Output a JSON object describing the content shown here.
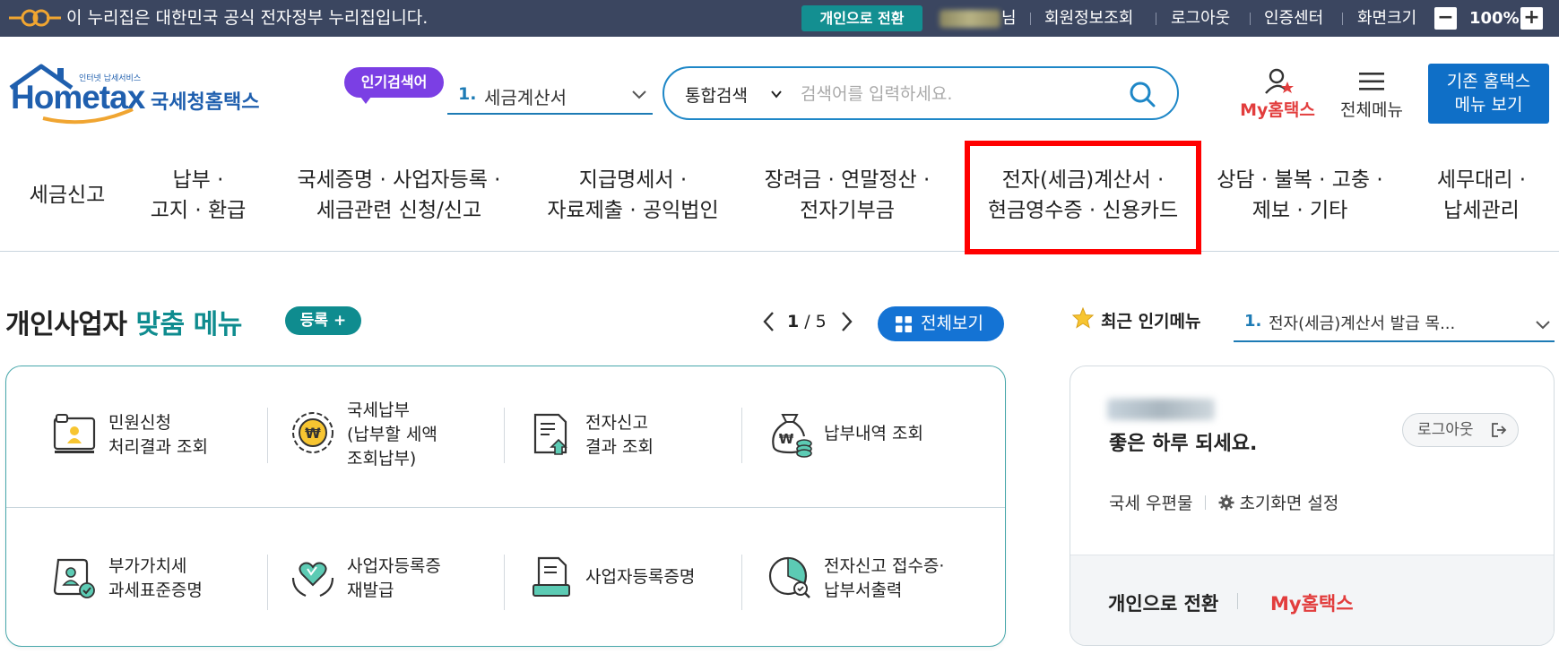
{
  "topbar": {
    "gov_notice": "이 누리집은 대한민국 공식 전자정부 누리집입니다.",
    "switch_label": "개인으로 전환",
    "user_suffix": "님",
    "links": [
      "회원정보조회",
      "로그아웃",
      "인증센터",
      "화면크기"
    ],
    "zoom_minus": "−",
    "zoom_value": "100%",
    "zoom_plus": "+"
  },
  "header": {
    "logo_top": "인터넷 납세서비스",
    "logo_main": "Hometax",
    "logo_sub": "국세청홈택스",
    "popular_badge": "인기검색어",
    "popular_rank": "1.",
    "popular_term": "세금계산서",
    "search_category": "통합검색",
    "search_placeholder": "검색어를 입력하세요.",
    "my_hometax": "My홈택스",
    "all_menu": "전체메뉴",
    "old_menu_line1": "기존 홈택스",
    "old_menu_line2": "메뉴 보기"
  },
  "nav": [
    "세금신고",
    "납부 ·\n고지 · 환급",
    "국세증명 · 사업자등록 ·\n세금관련 신청/신고",
    "지급명세서 ·\n자료제출 · 공익법인",
    "장려금 · 연말정산 ·\n전자기부금",
    "전자(세금)계산서 ·\n현금영수증 · 신용카드",
    "상담 · 불복 · 고충 ·\n제보 · 기타",
    "세무대리 ·\n납세관리"
  ],
  "custom_menu": {
    "title_main": "개인사업자",
    "title_accent": "맞춤 메뉴",
    "register_label": "등록 +",
    "page_current": "1",
    "page_sep": "/",
    "page_total": "5",
    "view_all": "전체보기",
    "items": [
      "민원신청\n처리결과 조회",
      "국세납부\n(납부할 세액\n조회납부)",
      "전자신고\n결과 조회",
      "납부내역 조회",
      "부가가치세\n과세표준증명",
      "사업자등록증\n재발급",
      "사업자등록증명",
      "전자신고 접수증·\n납부서출력"
    ]
  },
  "recent": {
    "title": "최근 인기메뉴",
    "rank": "1.",
    "item": "전자(세금)계산서 발급 목..."
  },
  "user_card": {
    "greeting": "좋은 하루 되세요.",
    "logout": "로그아웃",
    "link_mail": "국세 우편물",
    "link_settings": "초기화면 설정",
    "switch": "개인으로 전환",
    "my_hometax": "My홈택스"
  },
  "colors": {
    "topbar_bg": "#3b4660",
    "teal": "#0f8c8f",
    "blue": "#1473d4",
    "red_accent": "#e23d3d",
    "purple": "#7b3fe4",
    "highlight": "#ff0000"
  }
}
